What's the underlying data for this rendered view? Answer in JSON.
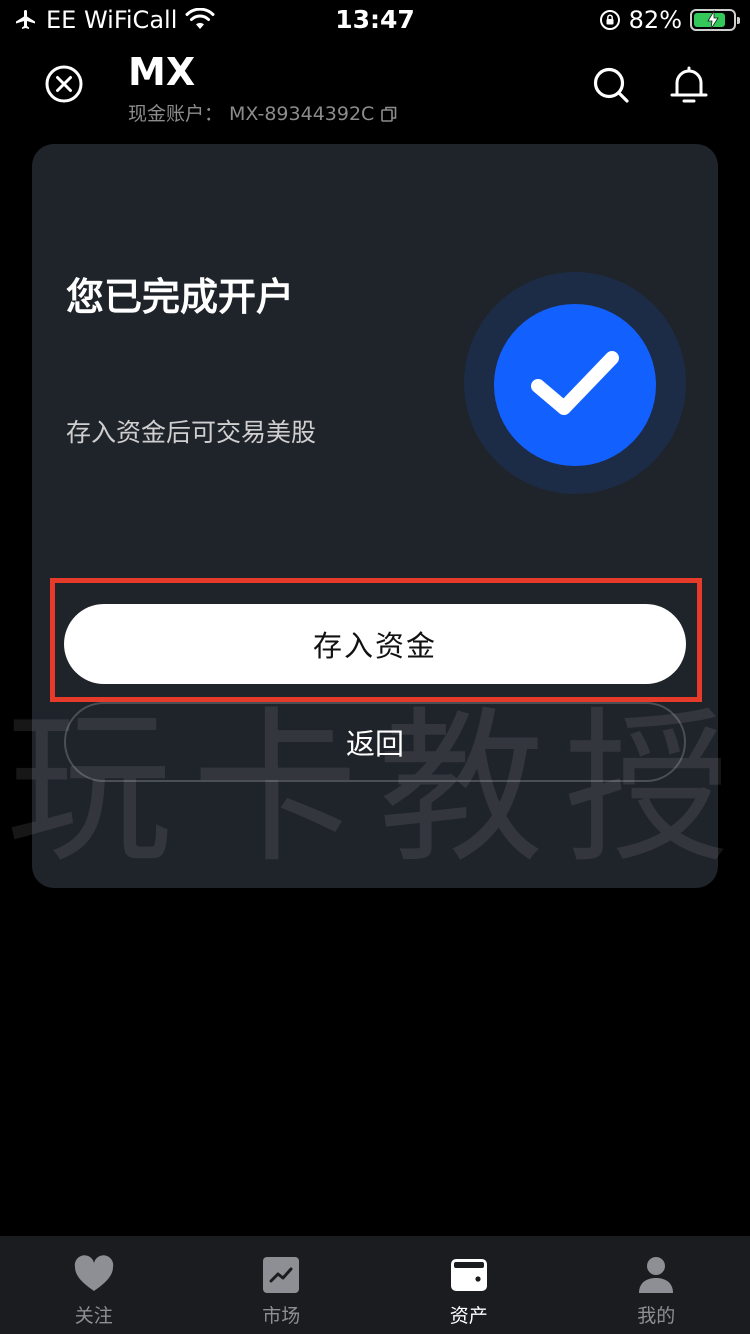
{
  "status_bar": {
    "carrier": "EE WiFiCall",
    "time": "13:47",
    "battery": "82%",
    "battery_level": 0.82
  },
  "header": {
    "title": "MX",
    "account_label": "现金账户：",
    "account_number": "MX-89344392C"
  },
  "card": {
    "title": "您已完成开户",
    "description": "存入资金后可交易美股",
    "deposit_label": "存入资金",
    "back_label": "返回"
  },
  "watermark": "玩卡教授",
  "tabs": [
    {
      "label": "关注",
      "icon": "heart-icon",
      "active": false
    },
    {
      "label": "市场",
      "icon": "chart-icon",
      "active": false
    },
    {
      "label": "资产",
      "icon": "wallet-icon",
      "active": true
    },
    {
      "label": "我的",
      "icon": "user-icon",
      "active": false
    }
  ],
  "colors": {
    "background": "#000000",
    "card": "#1f232a",
    "accent": "#1261ff",
    "highlight": "#e63b2a",
    "battery_green": "#34c759"
  }
}
